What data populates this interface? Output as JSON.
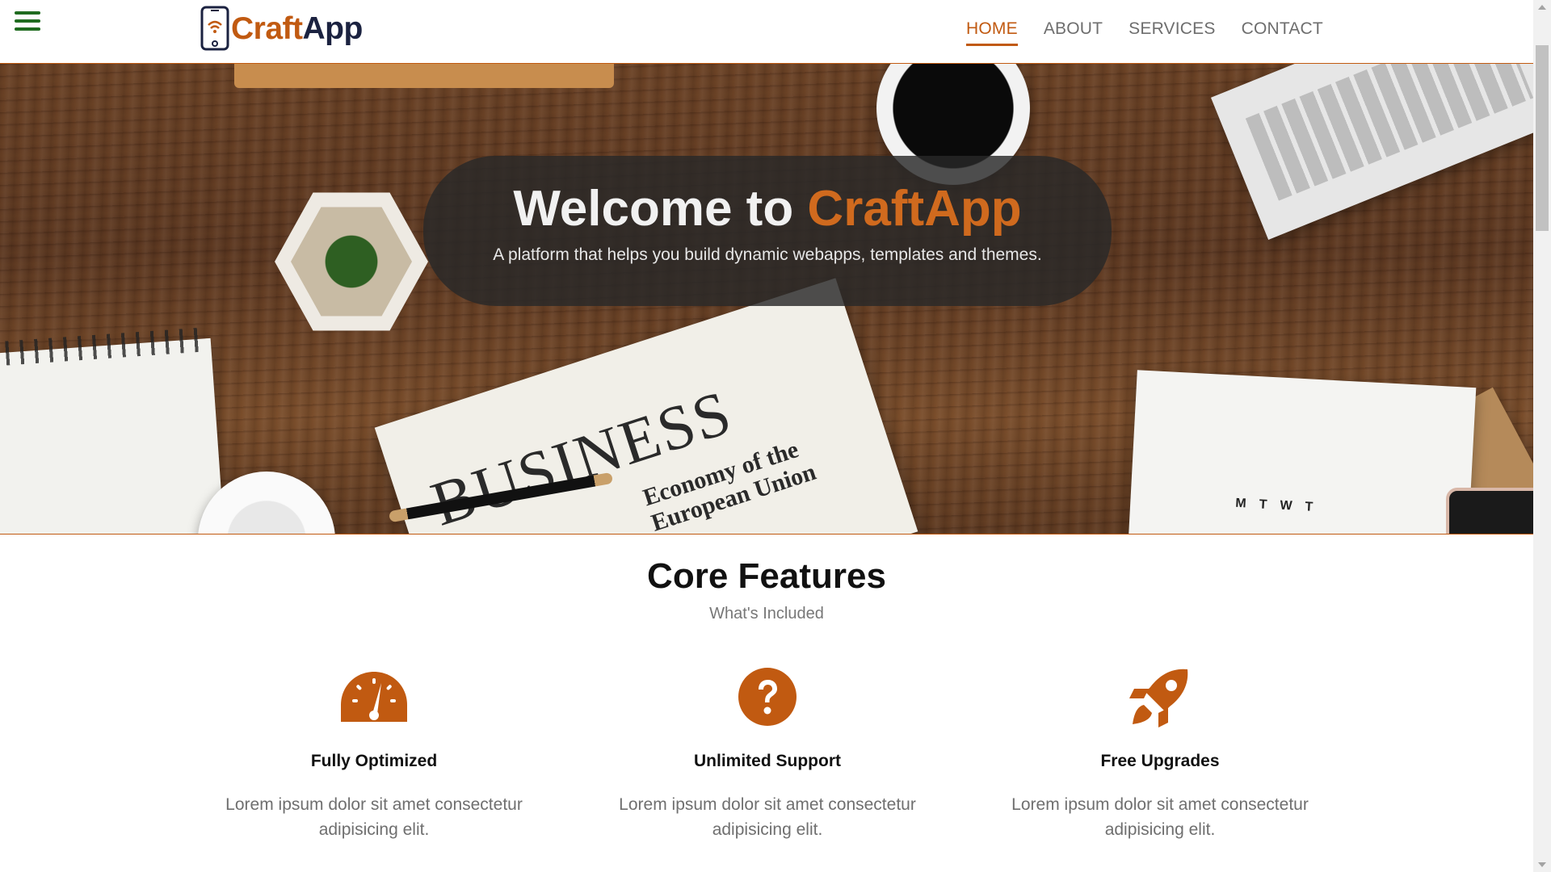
{
  "brand": {
    "part1": "Craft",
    "part2": "App",
    "accent_color": "#c15a11",
    "dark_color": "#1b2240"
  },
  "nav": {
    "items": [
      {
        "label": "HOME",
        "active": true
      },
      {
        "label": "ABOUT",
        "active": false
      },
      {
        "label": "SERVICES",
        "active": false
      },
      {
        "label": "CONTACT",
        "active": false
      }
    ]
  },
  "hero": {
    "title_prefix": "Welcome to",
    "title_accent": "CraftApp",
    "subtitle": "A platform that helps you build dynamic webapps, templates and themes."
  },
  "features": {
    "title": "Core Features",
    "subtitle": "What's Included",
    "items": [
      {
        "icon": "speedometer-icon",
        "title": "Fully Optimized",
        "text_line1": "Lorem ipsum dolor sit amet consectetur",
        "text_line2": "adipisicing elit."
      },
      {
        "icon": "question-circle-icon",
        "title": "Unlimited Support",
        "text_line1": "Lorem ipsum dolor sit amet consectetur",
        "text_line2": "adipisicing elit."
      },
      {
        "icon": "rocket-icon",
        "title": "Free Upgrades",
        "text_line1": "Lorem ipsum dolor sit amet consectetur",
        "text_line2": "adipisicing elit."
      }
    ]
  },
  "colors": {
    "hamburger": "#1f6b1f",
    "accent": "#c15a11",
    "nav_text": "#6e6e6e"
  }
}
